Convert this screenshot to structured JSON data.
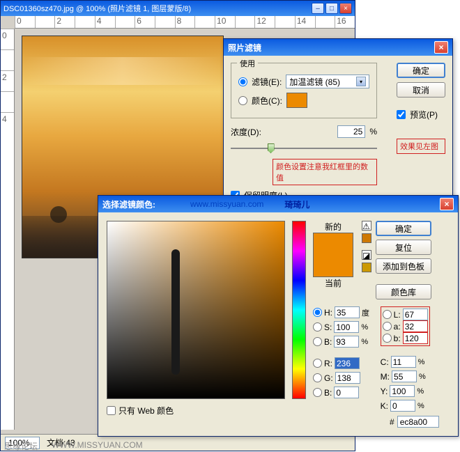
{
  "main": {
    "title": "DSC01360sz470.jpg @ 100% (照片滤镜 1, 图层蒙版/8)",
    "ruler_h": [
      "0",
      "",
      "2",
      "",
      "4",
      "",
      "6",
      "",
      "8",
      "",
      "10",
      "",
      "12",
      "",
      "14",
      "",
      "16"
    ],
    "ruler_v": [
      "0",
      "",
      "2",
      "",
      "4"
    ],
    "zoom": "100%",
    "doc_label": "文档:43"
  },
  "pf": {
    "title": "照片滤镜",
    "group": "使用",
    "radio_filter": "滤镜(E):",
    "radio_color": "颜色(C):",
    "filter_sel": "加温滤镜 (85)",
    "swatch": "#ec8a00",
    "density_label": "浓度(D):",
    "density_val": "25",
    "density_unit": "%",
    "preserve": "保留明度(L)",
    "ok": "确定",
    "cancel": "取消",
    "preview": "预览(P)",
    "note1": "效果见左图",
    "note2": "颜色设置注意我红框里的数值"
  },
  "cp": {
    "title": "选择滤镜颜色:",
    "url": "www.missyuan.com",
    "cred": "琦琦儿",
    "new_label": "新的",
    "cur_label": "当前",
    "new_color": "#ec8a00",
    "cur_color": "#ec8a00",
    "ok": "确定",
    "cancel": "复位",
    "add": "添加到色板",
    "lib": "颜色库",
    "H": {
      "label": "H:",
      "val": "35",
      "unit": "度"
    },
    "S": {
      "label": "S:",
      "val": "100",
      "unit": "%"
    },
    "Bv": {
      "label": "B:",
      "val": "93",
      "unit": "%"
    },
    "R": {
      "label": "R:",
      "val": "236"
    },
    "G": {
      "label": "G:",
      "val": "138"
    },
    "B2": {
      "label": "B:",
      "val": "0"
    },
    "L": {
      "label": "L:",
      "val": "67"
    },
    "a": {
      "label": "a:",
      "val": "32"
    },
    "b": {
      "label": "b:",
      "val": "120"
    },
    "C": {
      "label": "C:",
      "val": "11",
      "unit": "%"
    },
    "M": {
      "label": "M:",
      "val": "55",
      "unit": "%"
    },
    "Y": {
      "label": "Y:",
      "val": "100",
      "unit": "%"
    },
    "K": {
      "label": "K:",
      "val": "0",
      "unit": "%"
    },
    "webonly": "只有 Web 颜色",
    "hex_label": "#",
    "hex": "ec8a00"
  },
  "footer": {
    "l": "思缘论坛",
    "r": "WWW.MISSYUAN.COM"
  }
}
